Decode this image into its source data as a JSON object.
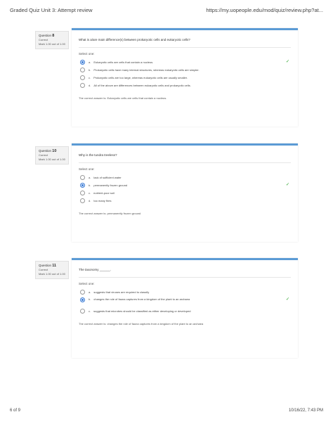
{
  "header": {
    "title": "Graded Quiz Unit 3: Attempt review",
    "url": "https://my.uopeople.edu/mod/quiz/review.php?at..."
  },
  "footer": {
    "page": "6 of 9",
    "datetime": "10/16/22, 7:43 PM"
  },
  "questions": [
    {
      "label": "Question",
      "number": "8",
      "status": "Correct",
      "mark": "Mark 1.00 out of 1.00",
      "text": "What is a/are main difference(s) between prokaryotic cells and eukaryotic cells?",
      "select_label": "Select one:",
      "options": [
        {
          "letter": "a.",
          "text": "Eukaryotic cells are cells that contain a nucleus."
        },
        {
          "letter": "b.",
          "text": "Prokaryotic cells have many internal structures, whereas eukaryotic cells are simpler."
        },
        {
          "letter": "c.",
          "text": "Prokaryotic cells are too large, whereas eukaryotic cells are usually smaller."
        },
        {
          "letter": "d.",
          "text": "All of the above are differences between eukaryotic cells and prokaryotic cells."
        }
      ],
      "selected_index": 0,
      "feedback": "The correct answer is: Eukaryotic cells are cells that contain a nucleus."
    },
    {
      "label": "Question",
      "number": "10",
      "status": "Correct",
      "mark": "Mark 1.00 out of 1.00",
      "text": "Why is the tundra treeless?",
      "select_label": "Select one:",
      "options": [
        {
          "letter": "a.",
          "text": "lack of sufficient water"
        },
        {
          "letter": "b.",
          "text": "permanently frozen ground"
        },
        {
          "letter": "c.",
          "text": "nutrient-poor soil"
        },
        {
          "letter": "d.",
          "text": "too many fires"
        }
      ],
      "selected_index": 1,
      "feedback": "The correct answer is: permanently frozen ground"
    },
    {
      "label": "Question",
      "number": "11",
      "status": "Correct",
      "mark": "Mark 1.00 out of 1.00",
      "text": "The taxonomy ______.",
      "select_label": "Select one:",
      "options": [
        {
          "letter": "a.",
          "text": "suggests that viruses are required to classify"
        },
        {
          "letter": "b.",
          "text": "changes the role of fauna captures from a kingdom of the plant to an archaea"
        },
        {
          "letter": "c.",
          "text": "suggests that microbes should be classified as either developing or developed"
        }
      ],
      "selected_index": 1,
      "feedback": "The correct answer is: changes the role of fauna captures from a kingdom of the plant to an archaea"
    }
  ]
}
